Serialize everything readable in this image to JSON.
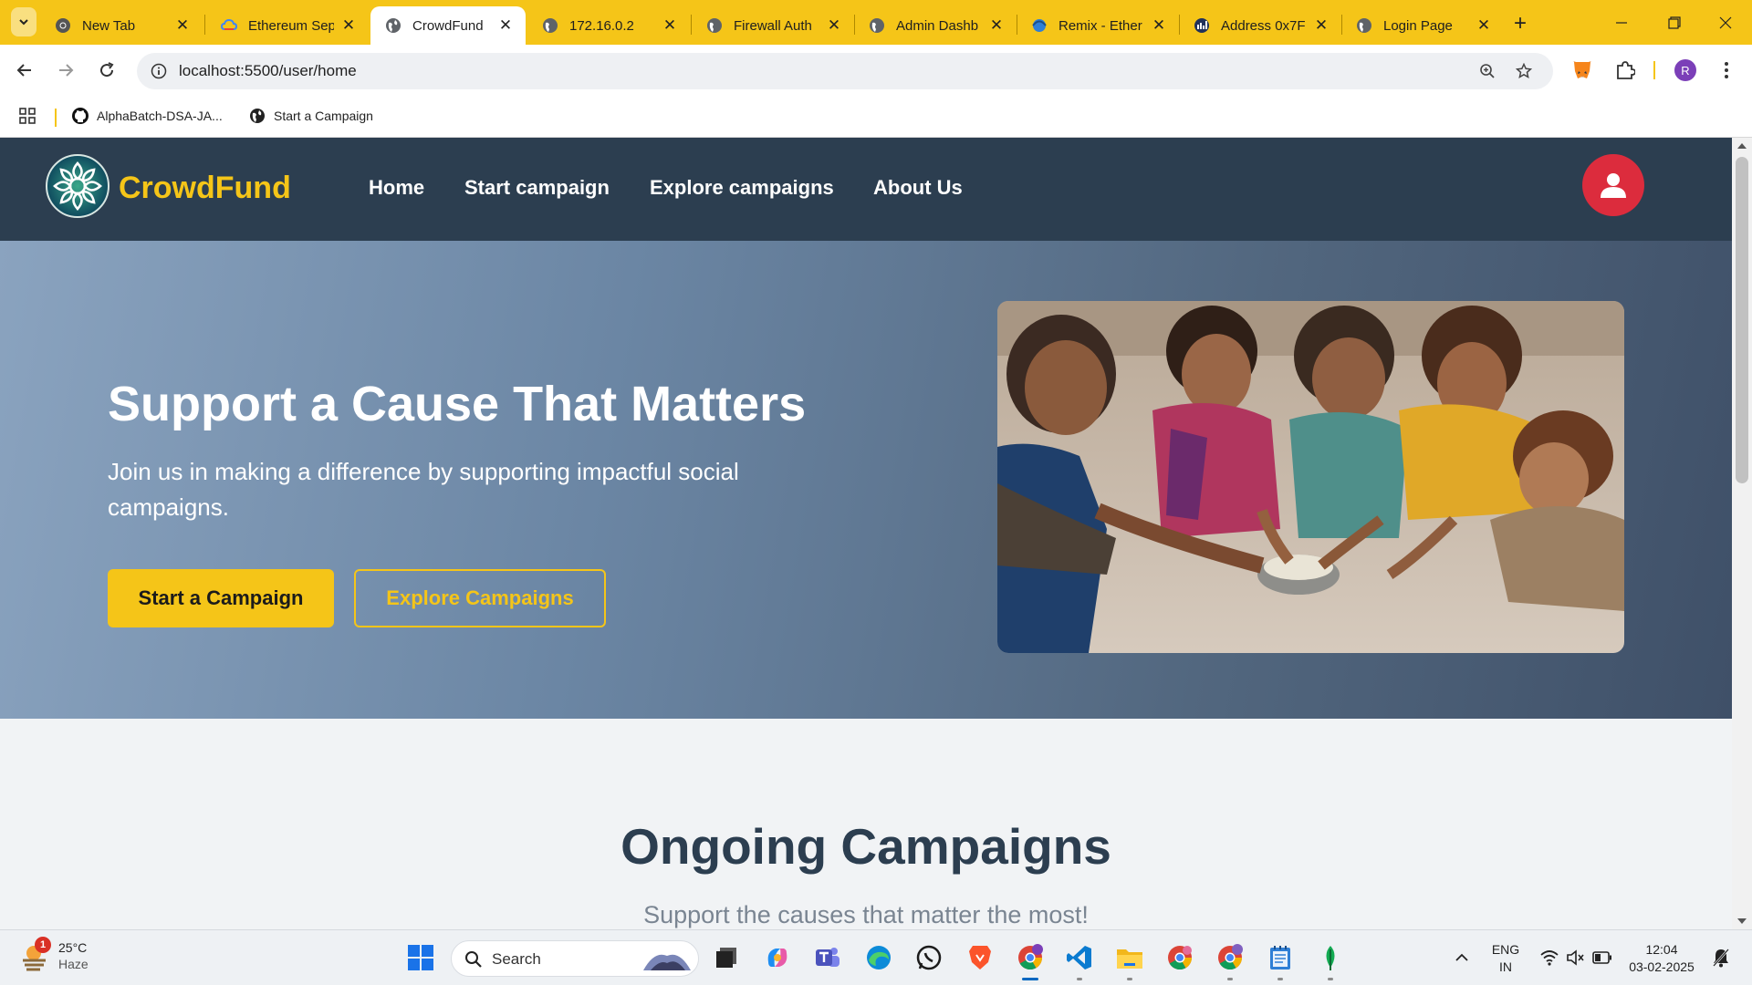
{
  "browser": {
    "tabs": [
      {
        "title": "New Tab",
        "icon": "chrome-icon",
        "active": false
      },
      {
        "title": "Ethereum Sep",
        "icon": "cloud-icon",
        "active": false
      },
      {
        "title": "CrowdFund",
        "icon": "globe-icon",
        "active": true
      },
      {
        "title": "172.16.0.2",
        "icon": "globe-icon",
        "active": false
      },
      {
        "title": "Firewall Auth",
        "icon": "globe-icon",
        "active": false
      },
      {
        "title": "Admin Dashb",
        "icon": "globe-icon",
        "active": false
      },
      {
        "title": "Remix - Ether",
        "icon": "remix-icon",
        "active": false
      },
      {
        "title": "Address 0x7F",
        "icon": "etherscan-icon",
        "active": false
      },
      {
        "title": "Login Page",
        "icon": "globe-icon",
        "active": false
      }
    ],
    "url": "localhost:5500/user/home",
    "profile_initial": "R",
    "bookmarks": [
      {
        "label": "AlphaBatch-DSA-JA...",
        "icon": "github-icon"
      },
      {
        "label": "Start a Campaign",
        "icon": "globe-icon"
      }
    ],
    "accent_color": "#f5c518"
  },
  "site": {
    "brand": "CrowdFund",
    "nav": [
      "Home",
      "Start campaign",
      "Explore campaigns",
      "About Us"
    ],
    "hero": {
      "title": "Support a Cause That Matters",
      "subtitle": "Join us in making a difference by supporting impactful social campaigns.",
      "primary_button": "Start a Campaign",
      "secondary_button": "Explore Campaigns"
    },
    "section": {
      "title": "Ongoing Campaigns",
      "subtitle": "Support the causes that matter the most!"
    },
    "colors": {
      "navbar": "#2c3e50",
      "brand": "#f5c518",
      "user_button": "#dc2c3d"
    }
  },
  "taskbar": {
    "weather": {
      "temp": "25°C",
      "condition": "Haze",
      "badge": "1"
    },
    "search_label": "Search",
    "language": {
      "line1": "ENG",
      "line2": "IN"
    },
    "time": "12:04",
    "date": "03-02-2025"
  }
}
